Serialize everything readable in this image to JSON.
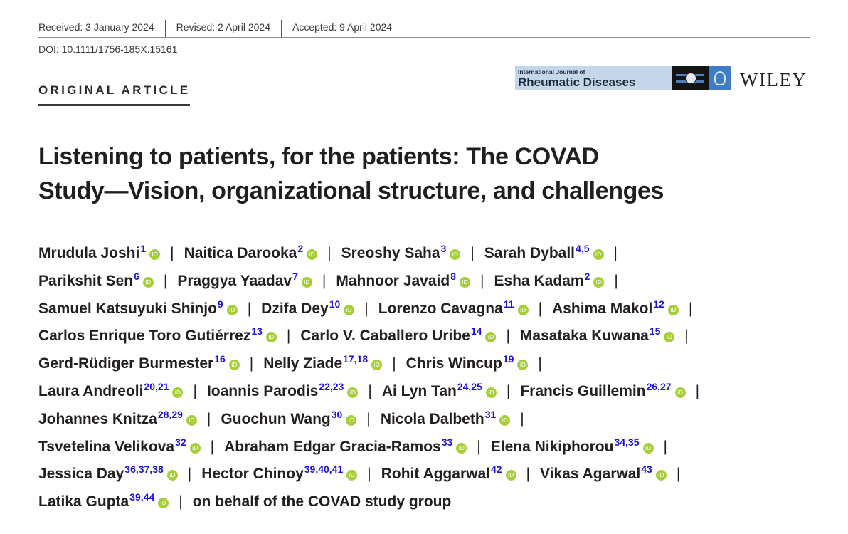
{
  "header": {
    "received": "Received: 3 January 2024",
    "revised": "Revised: 2 April 2024",
    "accepted": "Accepted: 9 April 2024",
    "doi": "DOI: 10.1111/1756-185X.15161",
    "article_type": "ORIGINAL ARTICLE"
  },
  "journal": {
    "name_small": "International Journal of",
    "name_big": "Rheumatic Diseases",
    "publisher": "WILEY",
    "colors": {
      "banner": "#c5d6ea",
      "logo_blue": "#3e7cc5",
      "logo_dark": "#141414"
    }
  },
  "title_line1": "Listening to patients, for the patients: The COVAD",
  "title_line2": "Study—Vision, organizational structure, and challenges",
  "orcid_icon": "orcid-icon",
  "orcid_label": "iD",
  "separator": "|",
  "colors": {
    "affiliation": "#1a12d8",
    "orcid": "#a6ce39"
  },
  "authors": [
    {
      "name": "Mrudula Joshi",
      "aff": "1"
    },
    {
      "name": "Naitica Darooka",
      "aff": "2"
    },
    {
      "name": "Sreoshy Saha",
      "aff": "3"
    },
    {
      "name": "Sarah Dyball",
      "aff": "4,5"
    },
    {
      "name": "Parikshit Sen",
      "aff": "6"
    },
    {
      "name": "Praggya Yaadav",
      "aff": "7"
    },
    {
      "name": "Mahnoor Javaid",
      "aff": "8"
    },
    {
      "name": "Esha Kadam",
      "aff": "2"
    },
    {
      "name": "Samuel Katsuyuki Shinjo",
      "aff": "9"
    },
    {
      "name": "Dzifa Dey",
      "aff": "10"
    },
    {
      "name": "Lorenzo Cavagna",
      "aff": "11"
    },
    {
      "name": "Ashima Makol",
      "aff": "12"
    },
    {
      "name": "Carlos Enrique Toro Gutiérrez",
      "aff": "13"
    },
    {
      "name": "Carlo V. Caballero Uribe",
      "aff": "14"
    },
    {
      "name": "Masataka Kuwana",
      "aff": "15"
    },
    {
      "name": "Gerd-Rüdiger Burmester",
      "aff": "16"
    },
    {
      "name": "Nelly Ziade",
      "aff": "17,18"
    },
    {
      "name": "Chris Wincup",
      "aff": "19"
    },
    {
      "name": "Laura Andreoli",
      "aff": "20,21"
    },
    {
      "name": "Ioannis Parodis",
      "aff": "22,23"
    },
    {
      "name": "Ai Lyn Tan",
      "aff": "24,25"
    },
    {
      "name": "Francis Guillemin",
      "aff": "26,27"
    },
    {
      "name": "Johannes Knitza",
      "aff": "28,29"
    },
    {
      "name": "Guochun Wang",
      "aff": "30"
    },
    {
      "name": "Nicola Dalbeth",
      "aff": "31"
    },
    {
      "name": "Tsvetelina Velikova",
      "aff": "32"
    },
    {
      "name": "Abraham Edgar Gracia-Ramos",
      "aff": "33"
    },
    {
      "name": "Elena Nikiphorou",
      "aff": "34,35"
    },
    {
      "name": "Jessica Day",
      "aff": "36,37,38"
    },
    {
      "name": "Hector Chinoy",
      "aff": "39,40,41"
    },
    {
      "name": "Rohit Aggarwal",
      "aff": "42"
    },
    {
      "name": "Vikas Agarwal",
      "aff": "43"
    },
    {
      "name": "Latika Gupta",
      "aff": "39,44"
    }
  ],
  "author_rows": [
    [
      0,
      1,
      2,
      3
    ],
    [
      4,
      5,
      6,
      7
    ],
    [
      8,
      9,
      10,
      11
    ],
    [
      12,
      13,
      14
    ],
    [
      15,
      16,
      17
    ],
    [
      18,
      19,
      20,
      21
    ],
    [
      22,
      23,
      24
    ],
    [
      25,
      26,
      27
    ],
    [
      28,
      29,
      30,
      31
    ],
    [
      32
    ]
  ],
  "group_note": "on behalf of the COVAD study group"
}
